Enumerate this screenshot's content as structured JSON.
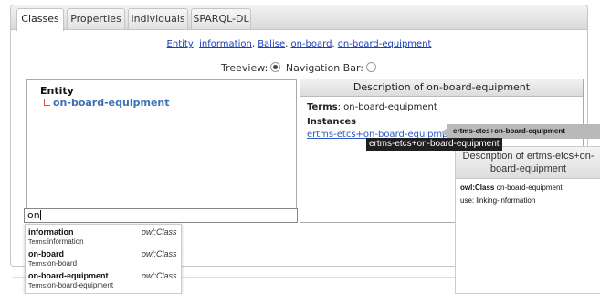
{
  "tabs": [
    {
      "label": "Classes",
      "active": true
    },
    {
      "label": "Properties",
      "active": false
    },
    {
      "label": "Individuals",
      "active": false
    },
    {
      "label": "SPARQL-DL",
      "active": false
    }
  ],
  "breadcrumb": {
    "items": [
      "Entity",
      "information",
      "Balise",
      "on-board",
      "on-board-equipment"
    ],
    "separator": ", "
  },
  "view_toggle": {
    "treeview_label": "Treeview:",
    "navbar_label": "Navigation Bar:",
    "selected": "Treeview"
  },
  "tree": {
    "root": "Entity",
    "child": "on-board-equipment"
  },
  "description": {
    "title": "Description of on-board-equipment",
    "terms_label": "Terms",
    "terms_value": ": on-board-equipment",
    "instances_label": "Instances",
    "instance_link": "ertms-etcs+on-board-equipment",
    "instance_comma": ","
  },
  "search": {
    "value": "on"
  },
  "autocomplete": [
    {
      "name": "information",
      "type": "owl:Class",
      "terms_prefix": "Terms:",
      "terms_value": "information"
    },
    {
      "name": "on-board",
      "type": "owl:Class",
      "terms_prefix": "Terms:",
      "terms_value": "on-board"
    },
    {
      "name": "on-board-equipment",
      "type": "owl:Class",
      "terms_prefix": "Terms:",
      "terms_value": "on-board-equipment"
    }
  ],
  "tooltip": {
    "text": "ertms-etcs+on-board-equipment"
  },
  "hover_label": {
    "text": "ertms-etcs+on-board-equipment"
  },
  "popup": {
    "title": "Description of ertms-etcs+on-board-equipment",
    "class_label": "owl:Class",
    "class_value": " on-board-equipment",
    "use_line": "use: linking-information"
  },
  "colors": {
    "link": "#1a3fbb",
    "tree_link": "#3b6fb6",
    "tree_elbow": "#e04a4a",
    "tooltip_bg": "#1f1f1f"
  }
}
